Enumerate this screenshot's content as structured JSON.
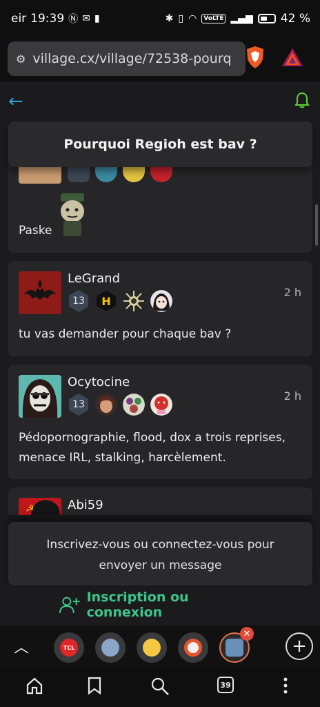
{
  "status_bar": {
    "carrier": "eir",
    "time": "19:39",
    "network": "VoLTE",
    "battery": "42 %"
  },
  "browser": {
    "url": "village.cx/village/72538-pourqu",
    "tab_count": "39"
  },
  "topic": {
    "title": "Pourquoi Regioh est bav ?"
  },
  "posts": [
    {
      "message": "Paske"
    },
    {
      "username": "LeGrand",
      "level": "13",
      "time": "2 h",
      "message": "tu vas demander pour chaque bav ?"
    },
    {
      "username": "Ocytocine",
      "level": "13",
      "time": "2 h",
      "message_line1": "Pédopornographie, flood, dox a trois reprises,",
      "message_line2": "menace IRL, stalking, harcèlement."
    },
    {
      "username": "Abi59"
    }
  ],
  "login": {
    "line1": "Inscrivez-vous ou connectez-vous pour",
    "line2": "envoyer un message",
    "button": "Inscription ou connexion"
  },
  "tabs": [
    {
      "icon": "tcl-icon",
      "label": "TCL"
    },
    {
      "icon": "sncf-icon"
    },
    {
      "icon": "smiley-icon"
    },
    {
      "icon": "app-icon"
    },
    {
      "icon": "village-icon"
    }
  ],
  "colors": {
    "accent_blue": "#2aa5d8",
    "accent_green": "#3dc58a",
    "background": "#1b1b1d",
    "card": "#262628"
  }
}
